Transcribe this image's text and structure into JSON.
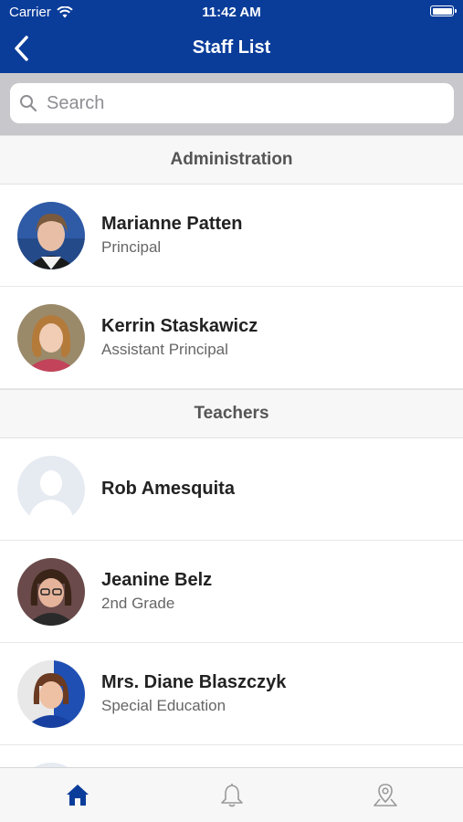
{
  "status_bar": {
    "carrier": "Carrier",
    "time": "11:42 AM"
  },
  "nav": {
    "title": "Staff List",
    "back_icon": "chevron-left-icon"
  },
  "search": {
    "placeholder": "Search"
  },
  "sections": [
    {
      "title": "Administration",
      "people": [
        {
          "name": "Marianne Patten",
          "title": "Principal",
          "photo": "photo"
        },
        {
          "name": "Kerrin Staskawicz",
          "title": "Assistant Principal",
          "photo": "photo"
        }
      ]
    },
    {
      "title": "Teachers",
      "people": [
        {
          "name": "Rob Amesquita",
          "title": "",
          "photo": "placeholder"
        },
        {
          "name": "Jeanine Belz",
          "title": "2nd Grade",
          "photo": "photo"
        },
        {
          "name": "Mrs. Diane Blaszczyk",
          "title": "Special Education",
          "photo": "photo"
        }
      ]
    }
  ],
  "tabbar": {
    "tabs": [
      "home-icon",
      "bell-icon",
      "map-pin-icon"
    ],
    "active": "home-icon"
  },
  "colors": {
    "brand": "#0a3d9a",
    "search_bg": "#c8c8cc",
    "section_bg": "#f7f7f7"
  }
}
